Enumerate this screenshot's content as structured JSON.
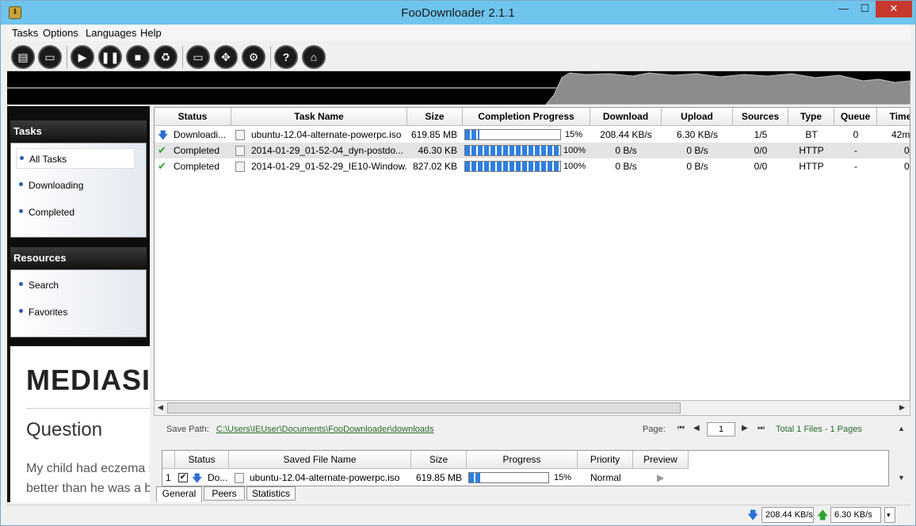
{
  "window": {
    "title": "FooDownloader 2.1.1",
    "close_glyph": "✕",
    "min_glyph": "—",
    "max_glyph": "☐"
  },
  "menu": [
    "Tasks",
    "Options",
    "Languages",
    "Help"
  ],
  "toolbar": {
    "buttons": [
      {
        "icon": "new-task-icon"
      },
      {
        "icon": "open-folder-icon"
      },
      {
        "icon": "start-icon"
      },
      {
        "icon": "pause-icon"
      },
      {
        "icon": "stop-icon"
      },
      {
        "icon": "delete-icon"
      },
      {
        "icon": "folder-icon"
      },
      {
        "icon": "fullscreen-icon"
      },
      {
        "icon": "settings-icon"
      },
      {
        "icon": "help-icon"
      },
      {
        "icon": "home-icon"
      }
    ]
  },
  "sidebar": {
    "tasks_heading": "Tasks",
    "task_items": [
      "All Tasks",
      "Downloading",
      "Completed"
    ],
    "resources_heading": "Resources",
    "resource_items": [
      "Search",
      "Favorites"
    ],
    "ad": {
      "logo": "MEDIASI",
      "question": "Question",
      "text_line1": "My child had eczema s",
      "text_line2": "better than he was a b"
    }
  },
  "tasklist": {
    "columns": [
      "Status",
      "Task Name",
      "Size",
      "Completion Progress",
      "Download",
      "Upload",
      "Sources",
      "Type",
      "Queue",
      "Time"
    ],
    "rows": [
      {
        "status": "Downloadi...",
        "status_icon": "download-arrow-icon",
        "name": "ubuntu-12.04-alternate-powerpc.iso",
        "size": "619.85 MB",
        "progress": 15,
        "progress_label": "15%",
        "download": "208.44 KB/s",
        "upload": "6.30 KB/s",
        "sources": "1/5",
        "type": "BT",
        "queue": "0",
        "time": "42m"
      },
      {
        "status": "Completed",
        "status_icon": "checkmark-icon",
        "name": "2014-01-29_01-52-04_dyn-postdo...",
        "size": "46.30 KB",
        "progress": 100,
        "progress_label": "100%",
        "download": "0 B/s",
        "upload": "0 B/s",
        "sources": "0/0",
        "type": "HTTP",
        "queue": "-",
        "time": "0"
      },
      {
        "status": "Completed",
        "status_icon": "checkmark-icon",
        "name": "2014-01-29_01-52-29_IE10-Window...",
        "size": "827.02 KB",
        "progress": 100,
        "progress_label": "100%",
        "download": "0 B/s",
        "upload": "0 B/s",
        "sources": "0/0",
        "type": "HTTP",
        "queue": "-",
        "time": "0"
      }
    ]
  },
  "details": {
    "save_path_label": "Save Path:",
    "save_path": "C:\\Users\\IEUser\\Documents\\FooDownloader\\downloads",
    "page_label": "Page:",
    "page_value": "1",
    "total": "Total 1 Files - 1 Pages",
    "columns": [
      "Status",
      "Saved File Name",
      "Size",
      "Progress",
      "Priority",
      "Preview"
    ],
    "row": {
      "index": "1",
      "status": "Do...",
      "name": "ubuntu-12.04-alternate-powerpc.iso",
      "size": "619.85 MB",
      "progress": 15,
      "progress_label": "15%",
      "priority": "Normal"
    },
    "tabs": [
      "General",
      "Peers",
      "Statistics"
    ]
  },
  "statusbar": {
    "download": "208.44 KB/s",
    "upload": "6.30 KB/s"
  }
}
